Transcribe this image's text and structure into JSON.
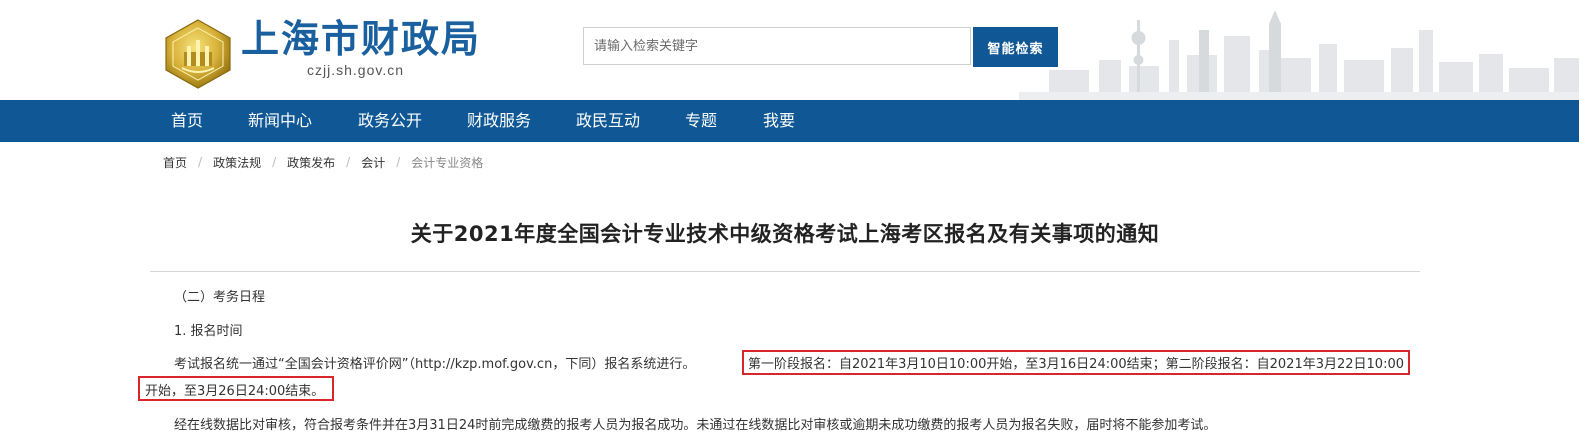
{
  "header": {
    "site_title": "上海市财政局",
    "site_domain": "czjj.sh.gov.cn",
    "search_placeholder": "请输入检索关键字",
    "search_button": "智能检索"
  },
  "nav": {
    "items": [
      "首页",
      "新闻中心",
      "政务公开",
      "财政服务",
      "政民互动",
      "专题",
      "我要"
    ]
  },
  "breadcrumb": {
    "items": [
      "首页",
      "政策法规",
      "政策发布",
      "会计",
      "会计专业资格"
    ]
  },
  "article": {
    "title": "关于2021年度全国会计专业技术中级资格考试上海考区报名及有关事项的通知",
    "section_heading": "（二）考务日程",
    "subheading": "1. 报名时间",
    "para1_prefix": "考试报名统一通过“全国会计资格评价网”（http://kzp.mof.gov.cn，下同）报名系统进行。",
    "para1_highlight_a": "第一阶段报名：自2021年3月10日10:00开始，至3月16日24:00结束；第二阶段报名：自2021年3月22日10:00",
    "para1_highlight_b": "开始，至3月26日24:00结束。",
    "para2": "经在线数据比对审核，符合报考条件并在3月31日24时前完成缴费的报考人员为报名成功。未通过在线数据比对审核或逾期未成功缴费的报考人员为报名失败，届时将不能参加考试。"
  },
  "colors": {
    "brand_blue": "#0f5895",
    "title_blue": "#1a5f9e",
    "highlight_red": "#d9262c"
  }
}
